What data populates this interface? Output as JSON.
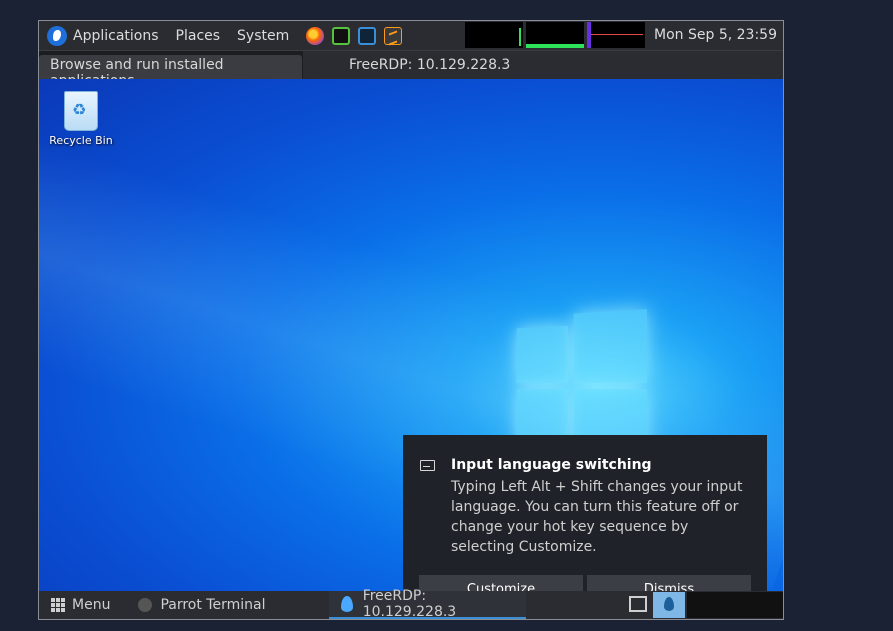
{
  "top_panel": {
    "menus": [
      "Applications",
      "Places",
      "System"
    ],
    "clock": "Mon Sep 5, 23:59"
  },
  "tooltip": "Browse and run installed applications",
  "rdp_window_title": "FreeRDP: 10.129.228.3",
  "desktop": {
    "recycle_bin_label": "Recycle Bin"
  },
  "notification": {
    "title": "Input language switching",
    "body": "Typing Left Alt + Shift changes your input language. You can turn this feature off or change your hot key sequence by selecting Customize.",
    "customize_label": "Customize",
    "dismiss_label": "Dismiss"
  },
  "bottom_panel": {
    "menu_label": "Menu",
    "tasks": [
      "Parrot Terminal",
      "FreeRDP: 10.129.228.3"
    ]
  },
  "icons": [
    "parrot-logo-icon",
    "firefox-icon",
    "terminal-icon",
    "powershell-icon",
    "sublime-icon",
    "keyboard-icon",
    "recycle-bin-icon",
    "grid-menu-icon",
    "water-drop-icon"
  ]
}
